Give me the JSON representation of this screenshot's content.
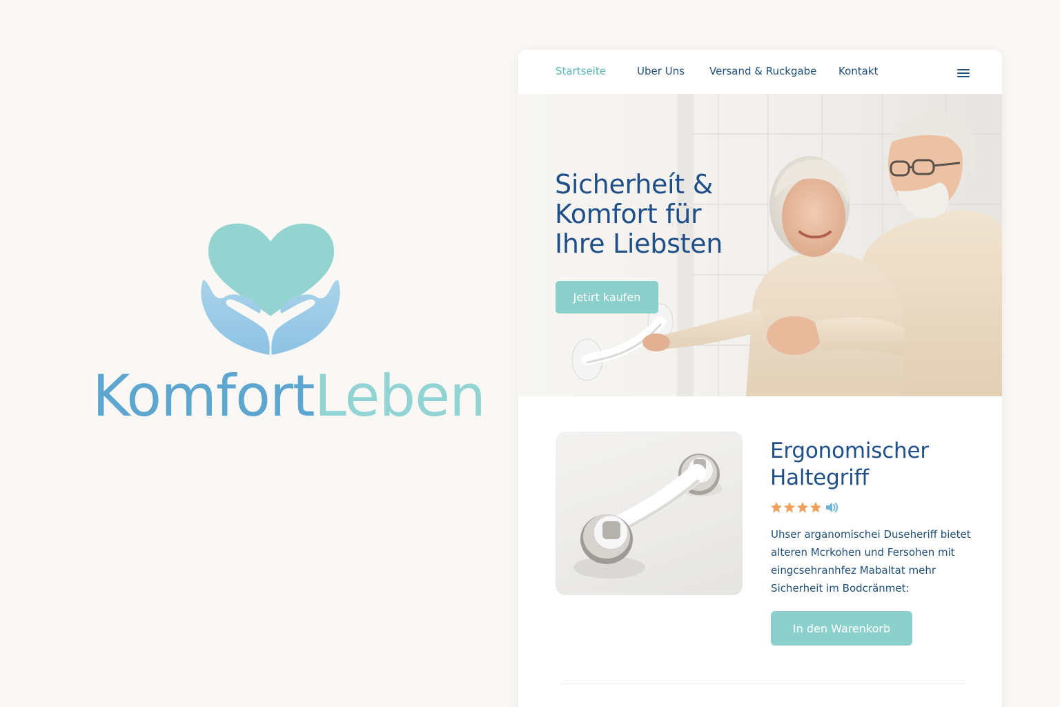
{
  "brand": {
    "name_part1": "Komfort",
    "name_part2": "Leben",
    "colors": {
      "heart": "#93d3d0",
      "hands": "#9ac9e6",
      "wordmark_start": "#5da6cf",
      "wordmark_end": "#92d3d3"
    }
  },
  "nav": {
    "items": [
      {
        "label": "Startseite",
        "active": true
      },
      {
        "label": "Uber Uns",
        "active": false
      },
      {
        "label": "Versand & Ruckgabe",
        "active": false
      },
      {
        "label": "Kontakt",
        "active": false
      }
    ],
    "menu_icon": "hamburger-menu-icon"
  },
  "hero": {
    "title": "Sicherheít & Komfort für Ihre Liebsten",
    "cta_label": "Jetirt kaufen"
  },
  "product": {
    "title": "Ergonomischer Haltegriff",
    "rating": 4,
    "rating_max": 4,
    "description": "Uhser arganomischei Duseheriff bietet alteren Mcrkohen und Fersohen mit eingcsehranhfez Mabaltat mehr Sicherheit im Bodcränmet:",
    "cart_label": "In den Warenkorb"
  },
  "colors": {
    "accent": "#8cd0cc",
    "heading": "#1f4f86",
    "nav_active": "#58b4b4",
    "star": "#f0a05a"
  }
}
